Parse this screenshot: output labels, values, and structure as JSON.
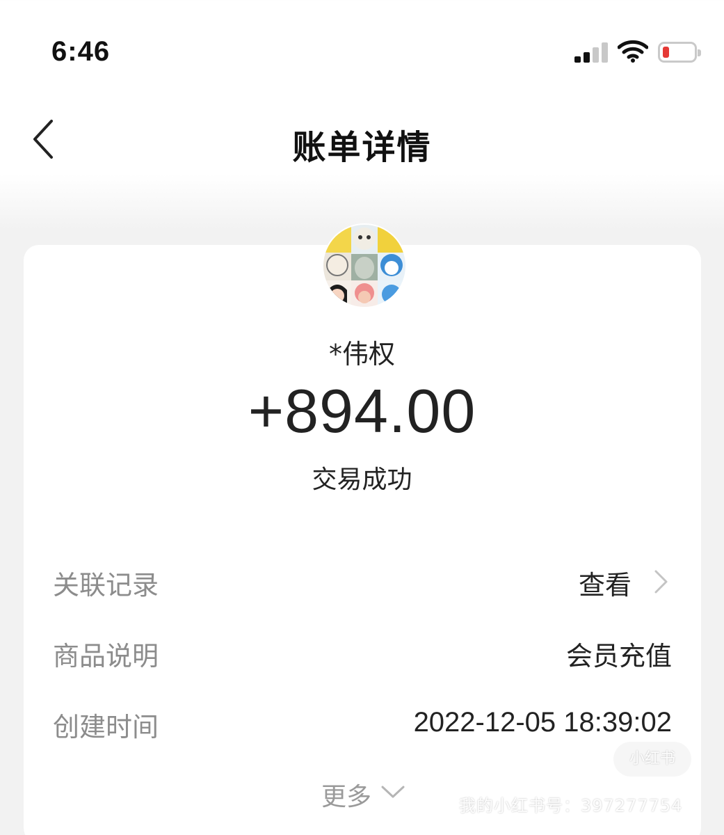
{
  "status_bar": {
    "time": "6:46",
    "signal_icon": "cellular-signal-icon",
    "wifi_icon": "wifi-icon",
    "battery_icon": "battery-low-icon",
    "battery_level": 0.12,
    "battery_color": "#e53935"
  },
  "nav": {
    "back_icon": "chevron-left-icon",
    "title": "账单详情"
  },
  "transaction": {
    "avatar": "cartoon-collage-avatar",
    "payer_name": "*伟权",
    "amount": "+894.00",
    "status": "交易成功"
  },
  "details": {
    "related": {
      "label": "关联记录",
      "value": "查看",
      "icon": "chevron-right-icon"
    },
    "product": {
      "label": "商品说明",
      "value": "会员充值"
    },
    "created": {
      "label": "创建时间",
      "value": "2022-12-05 18:39:02"
    }
  },
  "more": {
    "label": "更多",
    "icon": "chevron-down-icon"
  },
  "watermark": {
    "logo_text": "小红书",
    "account_text": "我的小红书号：397277754"
  },
  "colors": {
    "text_primary": "#222222",
    "text_secondary": "#8c8c8c",
    "page_background": "#f2f2f2",
    "card_background": "#ffffff"
  }
}
